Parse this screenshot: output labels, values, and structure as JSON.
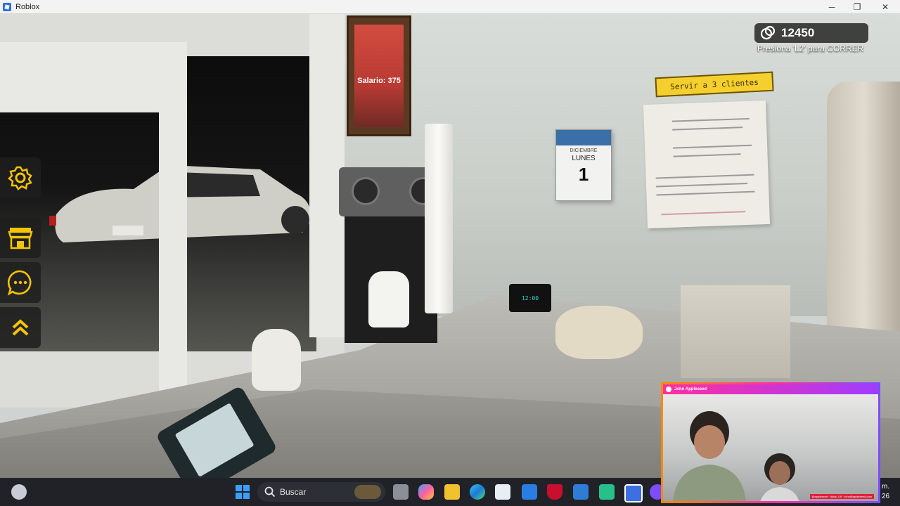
{
  "window": {
    "title": "Roblox",
    "minimize_label": "─",
    "maximize_label": "❐",
    "close_label": "✕"
  },
  "hud": {
    "money": "12450",
    "run_hint": "Presiona 'L2' para CORRER",
    "task": "Servir a 3 clientes"
  },
  "sidebar": {
    "buttons": [
      {
        "icon": "gear-icon"
      },
      {
        "icon": "shop-icon"
      },
      {
        "icon": "chat-icon"
      },
      {
        "icon": "double-chevron-up-icon"
      }
    ]
  },
  "scene": {
    "calendar": {
      "month": "DICIEMBRE",
      "weekday": "LUNES",
      "day": "1"
    },
    "poster": {
      "salary": "Salario: 375"
    },
    "clock": "12:00"
  },
  "webcam": {
    "name": "John Appleseed",
    "credit": "@appleseed · tiktok, UK · john@appleseed.com"
  },
  "taskbar": {
    "search_label": "Buscar",
    "clock_line1": "m.",
    "clock_line2": "26"
  }
}
